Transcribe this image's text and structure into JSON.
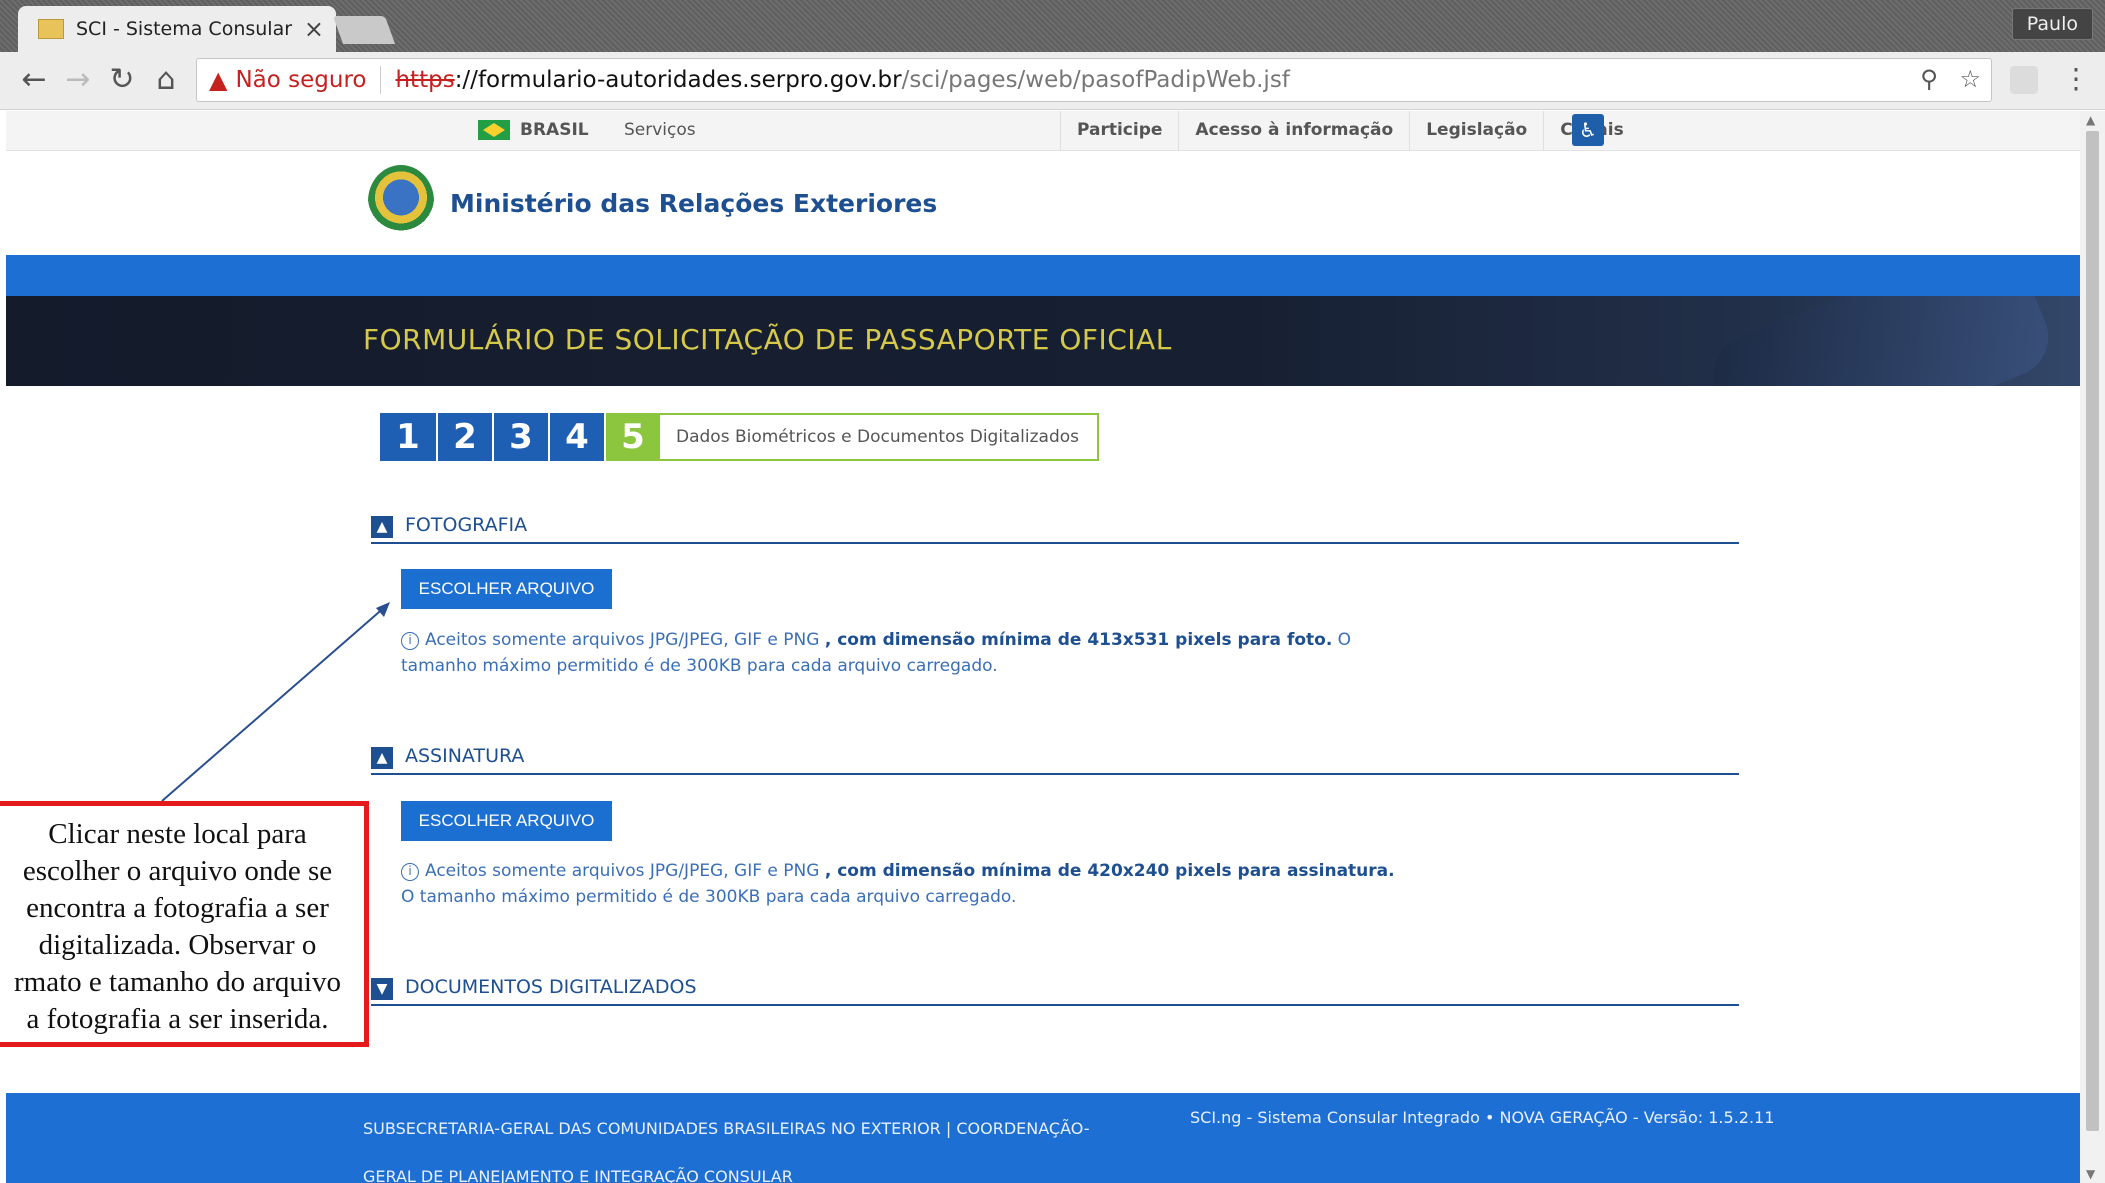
{
  "browser": {
    "tab_title": "SCI - Sistema Consular Inte",
    "profile_name": "Paulo",
    "security_label": "Não seguro",
    "url_scheme": "https",
    "url_separator": "://",
    "url_host": "formulario-autoridades.serpro.gov.br",
    "url_path": "/sci/pages/web/pasofPadipWeb.jsf"
  },
  "govbar": {
    "brasil_label": "BRASIL",
    "servicos_label": "Serviços",
    "links": [
      "Participe",
      "Acesso à informação",
      "Legislação",
      "Canais"
    ]
  },
  "header": {
    "ministry": "Ministério das Relações Exteriores",
    "form_title": "FORMULÁRIO DE SOLICITAÇÃO DE PASSAPORTE OFICIAL"
  },
  "steps": {
    "numbers": [
      "1",
      "2",
      "3",
      "4",
      "5"
    ],
    "current_label": "Dados Biométricos e Documentos Digitalizados"
  },
  "sections": {
    "fotografia": {
      "title": "FOTOGRAFIA",
      "button": "ESCOLHER ARQUIVO",
      "info_pre": "Aceitos somente arquivos JPG/JPEG, GIF e PNG ",
      "info_bold": ", com dimensão mínima de 413x531 pixels para foto.",
      "info_post": " O tamanho máximo permitido é de 300KB para cada arquivo carregado."
    },
    "assinatura": {
      "title": "ASSINATURA",
      "button": "ESCOLHER ARQUIVO",
      "info_pre": "Aceitos somente arquivos JPG/JPEG, GIF e PNG ",
      "info_bold": ", com dimensão mínima de 420x240 pixels para assinatura.",
      "info_post": " O tamanho máximo permitido é de 300KB para cada arquivo carregado."
    },
    "documentos": {
      "title": "DOCUMENTOS DIGITALIZADOS"
    }
  },
  "footer": {
    "left": "SUBSECRETARIA-GERAL DAS COMUNIDADES BRASILEIRAS NO EXTERIOR | COORDENAÇÃO-GERAL DE PLANEJAMENTO E INTEGRAÇÃO CONSULAR",
    "right": "SCI.ng - Sistema Consular Integrado • NOVA GERAÇÃO - Versão: 1.5.2.11"
  },
  "annotation": {
    "text": "Clicar neste local para\nescolher o arquivo onde se\nencontra a fotografia a ser\ndigitalizada. Observar o\nrmato e tamanho do arquivo\na fotografia a ser inserida."
  },
  "colors": {
    "accent_blue": "#1a6fd1",
    "step_active": "#8cc63e",
    "callout_border": "#e31b1b",
    "title_gold": "#d6c94a"
  }
}
